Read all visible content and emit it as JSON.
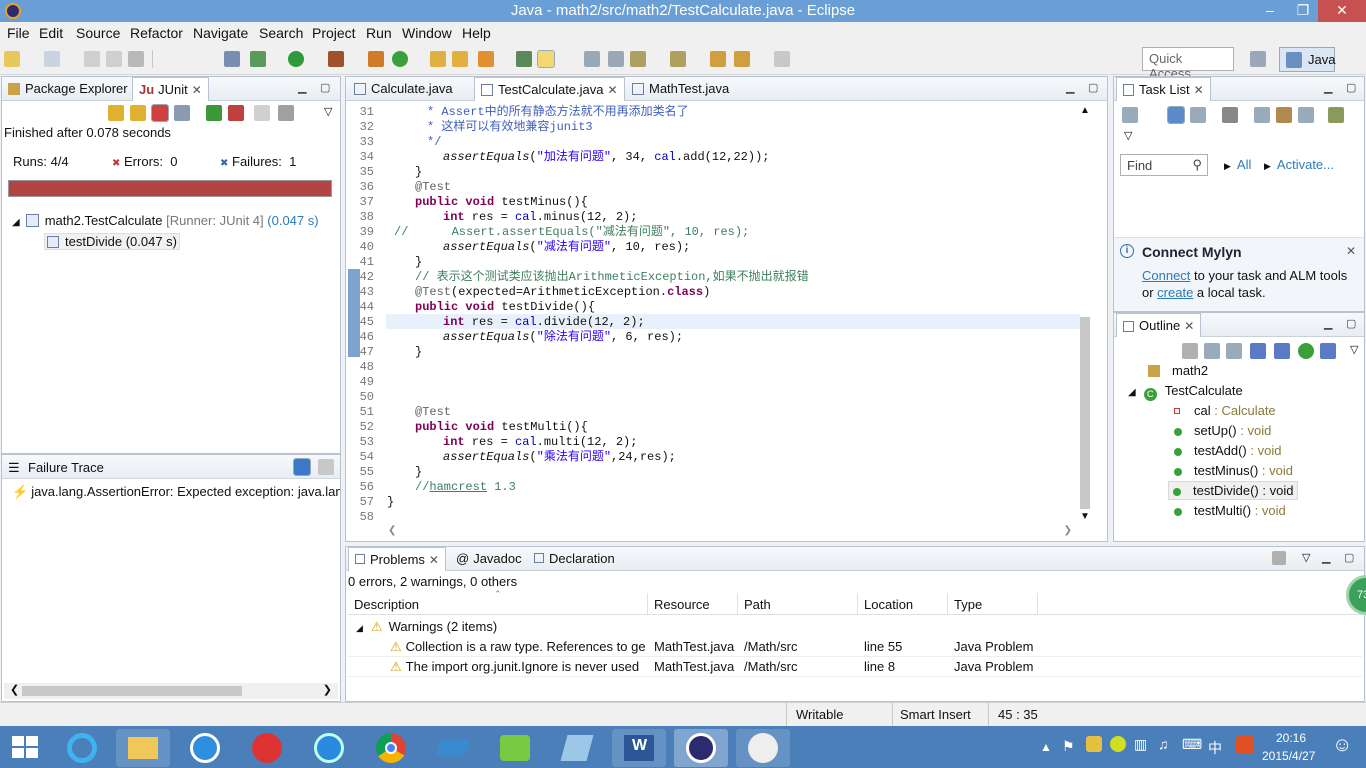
{
  "window": {
    "title": "Java - math2/src/math2/TestCalculate.java - Eclipse",
    "minimize": "–",
    "restore": "❐",
    "close": "✕"
  },
  "menu": [
    "File",
    "Edit",
    "Source",
    "Refactor",
    "Navigate",
    "Search",
    "Project",
    "Run",
    "Window",
    "Help"
  ],
  "toolbar": {
    "quick_access": "Quick Access",
    "perspective": "Java"
  },
  "left": {
    "tabs": [
      "Package Explorer",
      "JUnit"
    ],
    "finished": "Finished after 0.078 seconds",
    "runs_label": "Runs:",
    "runs": "4/4",
    "errors_label": "Errors:",
    "errors": "0",
    "failures_label": "Failures:",
    "failures": "1",
    "progress_fraction": 1.0,
    "progress_color": "#b24444",
    "tree": {
      "root": "math2.TestCalculate",
      "root_detail": "[Runner: JUnit 4]",
      "root_time": "(0.047 s)",
      "child": "testDivide (0.047 s)"
    },
    "failure_trace_title": "Failure Trace",
    "failure_trace": "java.lang.AssertionError: Expected exception: java.lang"
  },
  "editor": {
    "tabs": [
      "Calculate.java",
      "TestCalculate.java",
      "MathTest.java"
    ],
    "active_tab": 1,
    "line_numbers": [
      "31",
      "32",
      "33",
      "34",
      "35",
      "36",
      "37",
      "38",
      "39",
      "40",
      "41",
      "42",
      "43",
      "44",
      "45",
      "46",
      "47",
      "48",
      "49",
      "50",
      "51",
      "52",
      "53",
      "54",
      "55",
      "56",
      "57",
      "58"
    ],
    "lines": {
      "l31": "     * Assert中的所有静态方法就不用再添加类名了",
      "l32": "     * 这样可以有效地兼容junit3",
      "l33": "     */",
      "l34_a": "assertEquals",
      "l34_b": "(",
      "l34_s": "\"加法有问题\"",
      "l34_c": ", 34, ",
      "l34_f": "cal",
      "l34_d": ".add(12,22));",
      "l35": "}",
      "l36": "@Test",
      "l37_kw": "public void",
      "l37": " testMinus(){",
      "l38_kw": "int",
      "l38_a": " res = ",
      "l38_f": "cal",
      "l38_b": ".minus(12, 2);",
      "l39": "//      Assert.assertEquals(\"减法有问题\", 10, res);",
      "l40_a": "assertEquals",
      "l40_s": "\"减法有问题\"",
      "l40_b": ", 10, res);",
      "l41": "}",
      "l42": "// 表示这个测试类应该抛出ArithmeticException,如果不抛出就报错",
      "l43_a": "@Test",
      "l43_b": "(expected=ArithmeticException.",
      "l43_kw": "class",
      "l43_c": ")",
      "l44_kw": "public void",
      "l44": " testDivide(){",
      "l45_kw": "int",
      "l45_a": " res = ",
      "l45_f": "cal",
      "l45_b": ".divide(12, 2);",
      "l46_a": "assertEquals",
      "l46_s": "\"除法有问题\"",
      "l46_b": ", 6, res);",
      "l47": "}",
      "l51": "@Test",
      "l52_kw": "public void",
      "l52": " testMulti(){",
      "l53_kw": "int",
      "l53_a": " res = ",
      "l53_f": "cal",
      "l53_b": ".multi(12, 2);",
      "l54_a": "assertEquals",
      "l54_s": "\"乘法有问题\"",
      "l54_b": ",24,res);",
      "l55": "}",
      "l56_a": "//",
      "l56_b": "hamcrest",
      "l56_c": " 1.3",
      "l57": "}"
    }
  },
  "right": {
    "tasklist_title": "Task List",
    "find_placeholder": "Find",
    "all": "All",
    "activate": "Activate...",
    "mylyn_title": "Connect Mylyn",
    "mylyn_connect": "Connect",
    "mylyn_text1": " to your task and ALM tools",
    "mylyn_or": "or ",
    "mylyn_create": "create",
    "mylyn_text2": " a local task.",
    "outline_title": "Outline",
    "outline": {
      "package": "math2",
      "class": "TestCalculate",
      "members": [
        {
          "name": "cal",
          "type": " : Calculate"
        },
        {
          "name": "setUp()",
          "type": " : void"
        },
        {
          "name": "testAdd()",
          "type": " : void"
        },
        {
          "name": "testMinus()",
          "type": " : void"
        },
        {
          "name": "testDivide()",
          "type": " : void"
        },
        {
          "name": "testMulti()",
          "type": " : void"
        }
      ]
    }
  },
  "bottom": {
    "tabs": [
      "Problems",
      "Javadoc",
      "Declaration"
    ],
    "summary": "0 errors, 2 warnings, 0 others",
    "columns": [
      "Description",
      "Resource",
      "Path",
      "Location",
      "Type"
    ],
    "group": "Warnings (2 items)",
    "rows": [
      {
        "desc": "Collection is a raw type. References to ge",
        "res": "MathTest.java",
        "path": "/Math/src",
        "loc": "line 55",
        "type": "Java Problem"
      },
      {
        "desc": "The import org.junit.Ignore is never used",
        "res": "MathTest.java",
        "path": "/Math/src",
        "loc": "line 8",
        "type": "Java Problem"
      }
    ]
  },
  "status": {
    "writable": "Writable",
    "insert": "Smart Insert",
    "position": "45 : 35"
  },
  "taskbar": {
    "time": "20:16",
    "date": "2015/4/27",
    "ime": "中",
    "badge": "73"
  }
}
